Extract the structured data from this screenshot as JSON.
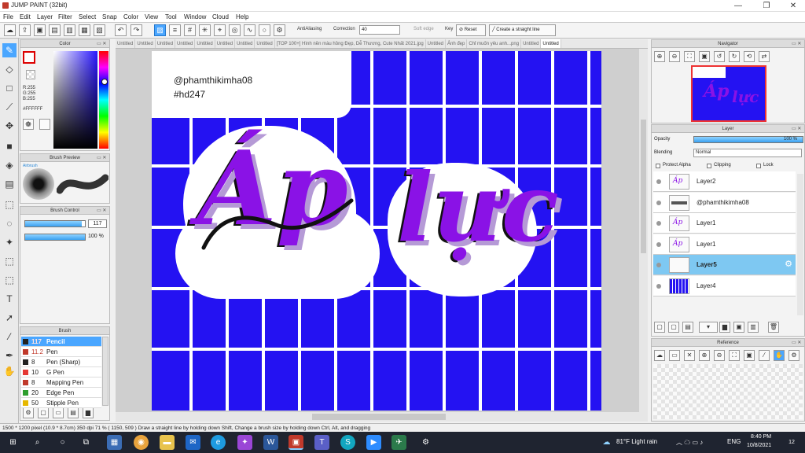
{
  "app": {
    "title": "JUMP PAINT (32bit)",
    "window_controls": [
      "—",
      "❐",
      "✕"
    ]
  },
  "menu": [
    "File",
    "Edit",
    "Layer",
    "Filter",
    "Select",
    "Snap",
    "Color",
    "View",
    "Tool",
    "Window",
    "Cloud",
    "Help"
  ],
  "toolbar": {
    "antialiasing": "AntiAliasing",
    "correction_label": "Correction",
    "correction_value": "40",
    "soft_edge": "Soft edge",
    "key_label": "Key",
    "reset": "Reset",
    "straight_line": "Create a straight line"
  },
  "panels": {
    "color": {
      "title": "Color",
      "r": "R:255",
      "g": "G:255",
      "b": "B:255",
      "hex": "#FFFFFF"
    },
    "brush_preview": {
      "title": "Brush Preview",
      "label": "Airbrush"
    },
    "brush_control": {
      "title": "Brush Control",
      "size": "117",
      "opacity": "100 %",
      "size_fill": 0.95,
      "opacity_fill": 1.0
    },
    "brush": {
      "title": "Brush",
      "items": [
        {
          "size": "117",
          "name": "Pencil",
          "color": "#222222"
        },
        {
          "size": "11.2",
          "name": "Pen",
          "color": "#c0392b"
        },
        {
          "size": "8",
          "name": "Pen (Sharp)",
          "color": "#222222"
        },
        {
          "size": "10",
          "name": "G Pen",
          "color": "#e53935"
        },
        {
          "size": "8",
          "name": "Mapping Pen",
          "color": "#c0392b"
        },
        {
          "size": "20",
          "name": "Edge Pen",
          "color": "#2e9e2e"
        },
        {
          "size": "50",
          "name": "Stipple Pen",
          "color": "#e6b800"
        }
      ]
    },
    "navigator": {
      "title": "Navigator"
    },
    "layer": {
      "title": "Layer",
      "opacity_label": "Opacity",
      "opacity_value": "100 %",
      "blending_label": "Blending",
      "blending_value": "Normal",
      "protect_alpha": "Protect Alpha",
      "clipping": "Clipping",
      "lock": "Lock",
      "layers": [
        {
          "name": "Layer2"
        },
        {
          "name": "@phamthikimha08"
        },
        {
          "name": "Layer1"
        },
        {
          "name": "Layer1"
        },
        {
          "name": "Layer5"
        },
        {
          "name": "Layer4"
        }
      ]
    },
    "reference": {
      "title": "Reference"
    }
  },
  "tabs": [
    "Untitled",
    "Untitled",
    "Untitled",
    "Untitled",
    "Untitled",
    "Untitled",
    "Untitled",
    "Untitled",
    "[TOP 100+] Hình nền màu hồng Đẹp, Dễ Thương, Cute Nhất 2021.jpg",
    "Untitled",
    "Ảnh đẹp",
    "Chỉ muốn yêu anh...png",
    "Untitled",
    "Untitled"
  ],
  "canvas": {
    "watermark_line1": "@phamthikimha08",
    "watermark_line2": "#hd247",
    "title_left": "Áp",
    "title_right": "lực",
    "bg_color": "#2412f2",
    "accent": "#8a12e6"
  },
  "status": {
    "text": "1500 * 1200 pixel  (10.9 * 8.7cm)  350 dpi  71 %  ( 1150, 509 )  Draw a straight line by holding down Shift, Change a brush size by holding down Ctrl, Alt, and dragging"
  },
  "taskbar": {
    "weather": "81°F  Light rain",
    "lang": "ENG",
    "time": "8:40 PM",
    "date": "10/8/2021",
    "notif": "12"
  }
}
